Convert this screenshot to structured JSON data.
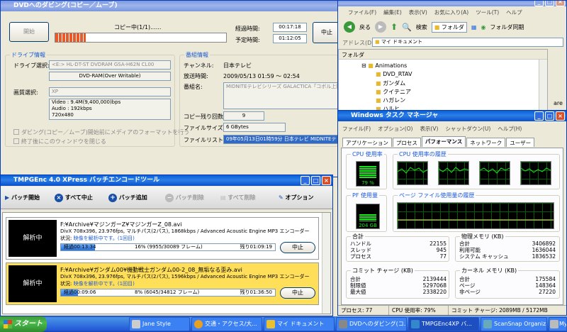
{
  "dub": {
    "title": "DVDへのダビング(コピー／ムーブ)",
    "start_btn": "開始",
    "progress_label": "コピー中(1/1)......",
    "progress_fraction": 0.18,
    "elapsed_label": "経過時間:",
    "elapsed": "00:17:18",
    "scheduled_label": "予定時間:",
    "scheduled": "01:12:05",
    "stop_btn": "中止",
    "drive_group": "ドライブ情報",
    "drive_select_label": "ドライブ選択:",
    "drive_value": "<E:> HL-DT-ST DVDRAM GSA-H62N CL00",
    "media_value": "DVD-RAM(Over Writable)",
    "quality_label": "画質選択:",
    "quality_value": "XP",
    "video_info": [
      "Video : 9.4M(9,400,000)bps",
      "Audio : 192kbps",
      "720x480"
    ],
    "check1": "ダビング(コピー／ムーブ)開始前にメディアのフォーマットを行う",
    "check2": "終了後にこのウィンドウを閉じる",
    "program_group": "番組情報",
    "channel_label": "チャンネル:",
    "channel": "日本テレビ",
    "airtime_label": "放送時間:",
    "airtime": "2009/05/13 01:59 ～ 02:54",
    "program_label": "番組名:",
    "program": "MIDNITEテレビシリーズ GALACTICA「コボル上陸作戦」",
    "copies_label": "コピー残り回数:",
    "copies": "9",
    "filesize_label": "ファイルサイズ:",
    "filesize": "6 GBytes",
    "filelist_label": "ファイルリスト:",
    "filelist": "09年05月13日01時59分 日本テレビ MIDNITEテレビシリーズ"
  },
  "explorer": {
    "menu": [
      "ファイル(F)",
      "編集(E)",
      "表示(V)",
      "お気に入り(A)",
      "ツール(T)",
      "ヘルプ"
    ],
    "back": "戻る",
    "search": "検索",
    "folder": "フォルダ",
    "sync": "フォルダ同期",
    "address_label": "アドレス(D)",
    "address": "マイ ドキュメント",
    "pane_title": "フォルダ",
    "tree": [
      "Animations",
      "DVD_RTAV",
      "ガンダム",
      "クイテニア",
      "ハガレン",
      "ハルヒ"
    ],
    "side_text": "are"
  },
  "taskmgr": {
    "title": "Windows タスク マネージャ",
    "menu": [
      "ファイル(F)",
      "オプション(O)",
      "表示(V)",
      "シャットダウン(U)",
      "ヘルプ(H)"
    ],
    "tabs": [
      "アプリケーション",
      "プロセス",
      "パフォーマンス",
      "ネットワーク",
      "ユーザー"
    ],
    "cpu_usage_title": "CPU 使用率",
    "cpu_value": "79 %",
    "cpu_history_title": "CPU 使用率の履歴",
    "pf_title": "PF 使用量",
    "pf_value": "204 GB",
    "pf_history_title": "ページ ファイル使用量の履歴",
    "totals_title": "合計",
    "totals": [
      [
        "ハンドル",
        "22155"
      ],
      [
        "スレッド",
        "945"
      ],
      [
        "プロセス",
        "77"
      ]
    ],
    "phys_title": "物理メモリ (KB)",
    "phys": [
      [
        "合計",
        "3406892"
      ],
      [
        "利用可能",
        "1636044"
      ],
      [
        "システム キャッシュ",
        "1836532"
      ]
    ],
    "commit_title": "コミット チャージ (KB)",
    "commit": [
      [
        "合計",
        "2139444"
      ],
      [
        "制限値",
        "5297068"
      ],
      [
        "最大値",
        "2338220"
      ]
    ],
    "kernel_title": "カーネル メモリ (KB)",
    "kernel": [
      [
        "合計",
        "175584"
      ],
      [
        "ページ",
        "148364"
      ],
      [
        "非ページ",
        "27220"
      ]
    ],
    "status": [
      "プロセス: 77",
      "CPU 使用率: 79%",
      "コミット チャージ: 2089MB / 5172MB"
    ]
  },
  "tmpg": {
    "title": "TMPGEnc 4.0 XPress バッチエンコードツール",
    "tools": [
      "バッチ開始",
      "すべて中止",
      "バッチ追加",
      "バッチ削除",
      "すべて削除",
      "オプション"
    ],
    "items": [
      {
        "status": "解析中",
        "path": "F:¥Archive¥マジンガーZ¥マジンガーZ_08.avi",
        "info": "DivX 708x396, 23.976fps, マルチパス(2パス), 1868kbps / Advanced Acoustic Engine MP3 エンコーダー",
        "state_label": "状況:",
        "state": "映像を解析中です。(1回目)",
        "elapsed": "経過00:13:34",
        "progress_text": "16% (9955/30089 フレーム)",
        "remaining": "残り01:09:19",
        "fraction": 0.16,
        "stop": "中止"
      },
      {
        "status": "解析中",
        "path": "F:¥Archive¥ガンダム00¥機動戦士ガンダム00-2_08_無垢なる歪み.avi",
        "info": "DivX 708x396, 23.976fps, マルチパス(2パス), 1596kbps / Advanced Acoustic Engine MP3 エンコーダー",
        "state_label": "状況:",
        "state": "映像を解析中です。(1回目)",
        "elapsed": "経過00:09:06",
        "progress_text": "8% (6045/34812 フレーム)",
        "remaining": "残り01:36:50",
        "fraction": 0.08,
        "stop": "中止"
      }
    ]
  },
  "taskbar": {
    "start": "スタート",
    "buttons": [
      "Jane Style",
      "交通・アクセス/大...",
      "マイ ドキュメント",
      "DVDへのダビング(コ...",
      "TMPGEnc4XP バ...",
      "ScanSnap Organiz...",
      "My"
    ]
  }
}
